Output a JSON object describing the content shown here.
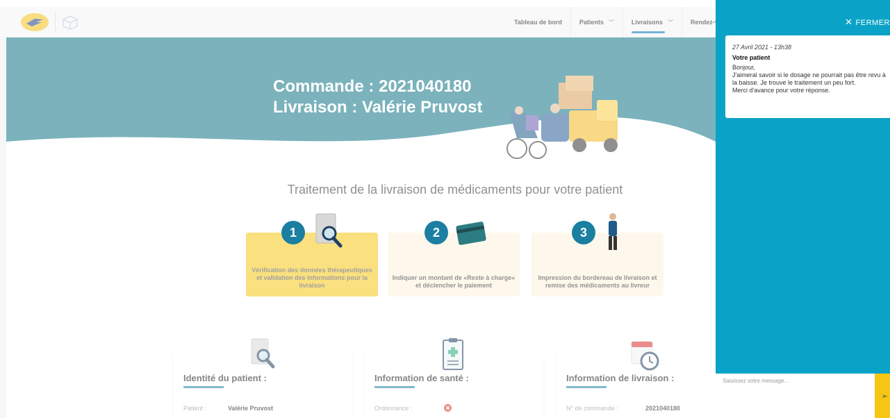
{
  "nav": {
    "items": [
      {
        "label": "Tableau de bord",
        "has_chevron": false
      },
      {
        "label": "Patients",
        "has_chevron": true
      },
      {
        "label": "Livraisons",
        "has_chevron": true,
        "active": true
      },
      {
        "label": "Rendez-vous",
        "has_chevron": false
      }
    ]
  },
  "hero": {
    "line1": "Commande : 2021040180",
    "line2": "Livraison : Valérie Pruvost"
  },
  "process": {
    "title": "Traitement de la livraison de médicaments pour votre patient",
    "steps": [
      {
        "number": "1",
        "text": "Vérification des données thérapeutiques et validation des informations pour la livraison"
      },
      {
        "number": "2",
        "text": "Indiquer un montant de «Reste à charge» et déclencher le paiement"
      },
      {
        "number": "3",
        "text": "Impression du bordereau de livraison et remise des médicaments au livreur"
      }
    ]
  },
  "cards": {
    "identity": {
      "title": "Identité du patient :",
      "row_label": "Patient :",
      "row_value": "Valérie Pruvost"
    },
    "health": {
      "title": "Information de santé :",
      "row_label": "Ordonnance :"
    },
    "delivery": {
      "title": "Information de livraison :",
      "row_label": "N° de commande :",
      "row_value": "2021040180"
    }
  },
  "chat": {
    "close_label": "FERMER",
    "message": {
      "date": "27 Avril 2021 - 13h38",
      "author": "Votre patient",
      "body": "Bonjour,\nJ'aimeral savoir si le dosage ne pourrait pas être revu à la baisse. Je trouve le traitement un peu fort.\nMerci d'avance pour votre réponse."
    },
    "input_placeholder": "Saisissez votre message..."
  },
  "colors": {
    "teal": "#1a7fa0",
    "panel": "#0aa3c7",
    "yellow": "#f6c614",
    "error_red": "#d9302f"
  }
}
